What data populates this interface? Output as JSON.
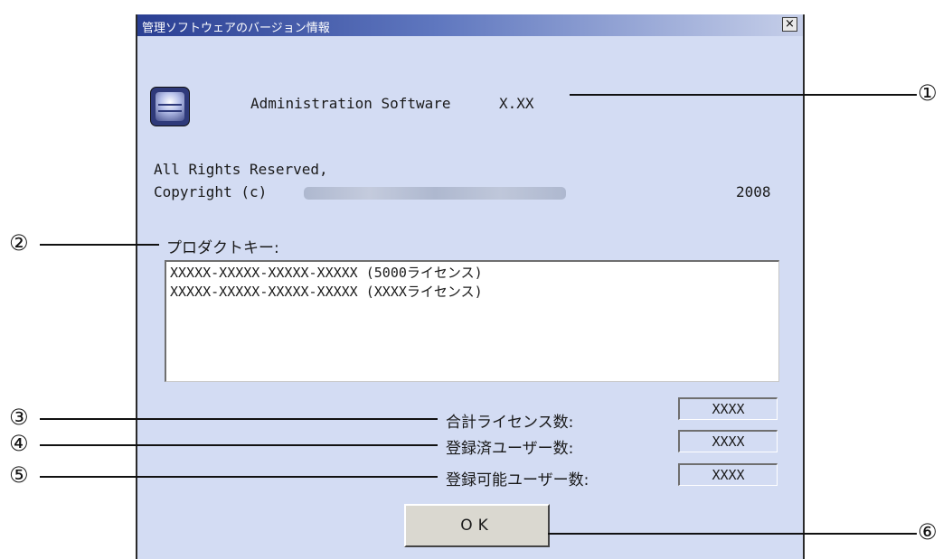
{
  "dialog": {
    "title": "管理ソフトウェアのバージョン情報",
    "close_label": "×",
    "app_name": "Administration Software",
    "version": "X.XX",
    "rights": "All Rights Reserved,",
    "copyright_prefix": "Copyright (c)",
    "copyright_year": "2008",
    "product_key_label": "プロダクトキー:",
    "product_keys": [
      "XXXXX-XXXXX-XXXXX-XXXXX (5000ライセンス)",
      "XXXXX-XXXXX-XXXXX-XXXXX (XXXXライセンス)"
    ],
    "fields": [
      {
        "label": "合計ライセンス数:",
        "value": "XXXX"
      },
      {
        "label": "登録済ユーザー数:",
        "value": "XXXX"
      },
      {
        "label": "登録可能ユーザー数:",
        "value": "XXXX"
      }
    ],
    "ok_label": "OK"
  },
  "callouts": [
    "①",
    "②",
    "③",
    "④",
    "⑤",
    "⑥"
  ],
  "colors": {
    "dialog_bg": "#d3dcf3",
    "titlebar_start": "#2a3f93",
    "titlebar_end": "#c6cfe9",
    "button_face": "#dad8d0"
  }
}
